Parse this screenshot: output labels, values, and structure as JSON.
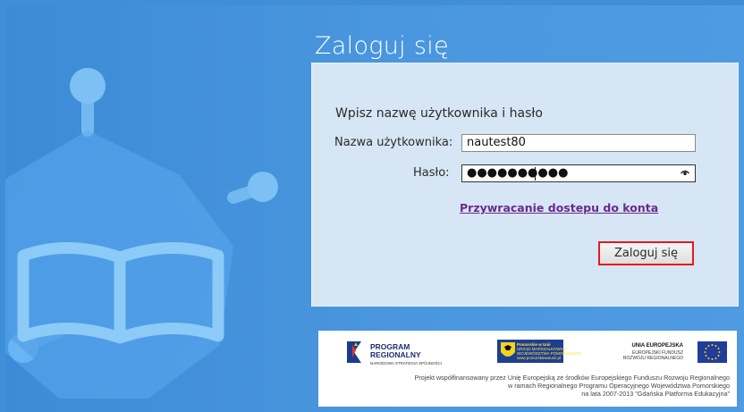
{
  "title": "Zaloguj się",
  "form": {
    "prompt": "Wpisz nazwę użytkownika i hasło",
    "username_label": "Nazwa użytkownika:",
    "username_value": "nautest80",
    "password_label": "Hasło:",
    "password_mask": "●●●●●●●●●●",
    "recovery_link": "Przywracanie dostepu do konta",
    "submit_label": "Zaloguj się"
  },
  "footer": {
    "logo_program_line1": "PROGRAM",
    "logo_program_line2": "REGIONALNY",
    "logo_program_sub": "NARODOWA STRATEGIA SPÓJNOŚCI",
    "logo_pomorskie_line1": "Pomorskie w Unii",
    "logo_pomorskie_line2": "URZĄD MARSZAŁKOWSKI",
    "logo_pomorskie_line3": "WOJEWÓDZTWA POMORSKIEGO",
    "logo_pomorskie_line4": "www.pomorskieweunii.pl",
    "eu_line1": "UNIA EUROPEJSKA",
    "eu_line2": "EUROPEJSKI FUNDUSZ",
    "eu_line3": "ROZWOJU REGIONALNEGO",
    "notice_line1": "Projekt współfinansowany przez Unię Europejską ze środków Europejskiego Funduszu Rozwoju Regionalnego",
    "notice_line2": "w ramach Regionalnego Programu Operacyjnego Województwa Pomorskiego",
    "notice_line3": "na lata 2007-2013 \"Gdańska Platforma Edukacyjna\""
  },
  "colors": {
    "background": "#4a97df",
    "panel": "#d6e6f4",
    "link": "#6b2a8c",
    "button_highlight": "#e21b1b"
  }
}
